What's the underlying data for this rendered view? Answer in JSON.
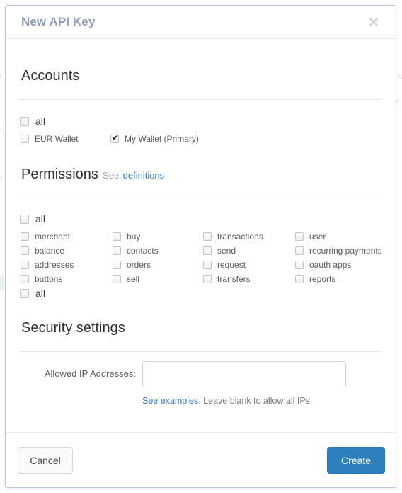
{
  "backdrop": {
    "ghost_fragments": [
      "t",
      "=",
      "1",
      "A",
      "c"
    ]
  },
  "modal": {
    "title": "New API Key",
    "close_icon": "close-icon",
    "sections": [
      {
        "id": "accounts",
        "heading": "Accounts",
        "all_label": "all",
        "all_checked": false,
        "items": [
          {
            "label": "EUR Wallet",
            "checked": false
          },
          {
            "label": "My Wallet (Primary)",
            "checked": true
          }
        ]
      },
      {
        "id": "permissions",
        "heading": "Permissions",
        "heading_suffix_plain": "See",
        "heading_suffix_link": "definitions",
        "all_label_top": "all",
        "all_checked_top": false,
        "all_label_bottom": "all",
        "all_checked_bottom": false,
        "columns": [
          {
            "items": [
              {
                "label": "merchant",
                "checked": false
              },
              {
                "label": "balance",
                "checked": false
              },
              {
                "label": "addresses",
                "checked": false
              },
              {
                "label": "buttons",
                "checked": false
              }
            ]
          },
          {
            "items": [
              {
                "label": "buy",
                "checked": false
              },
              {
                "label": "contacts",
                "checked": false
              },
              {
                "label": "orders",
                "checked": false
              },
              {
                "label": "sell",
                "checked": false
              }
            ]
          },
          {
            "items": [
              {
                "label": "transactions",
                "checked": false
              },
              {
                "label": "send",
                "checked": false
              },
              {
                "label": "request",
                "checked": false
              },
              {
                "label": "transfers",
                "checked": false
              }
            ]
          },
          {
            "items": [
              {
                "label": "user",
                "checked": false
              },
              {
                "label": "recurring payments",
                "checked": false
              },
              {
                "label": "oauth apps",
                "checked": false
              },
              {
                "label": "reports",
                "checked": false
              }
            ]
          }
        ]
      },
      {
        "id": "security",
        "heading": "Security settings",
        "field_label": "Allowed IP Addresses:",
        "field_value": "",
        "field_placeholder": "",
        "help_link": "See examples",
        "help_rest": ". Leave blank to allow all IPs."
      }
    ],
    "footer": {
      "cancel_label": "Cancel",
      "create_label": "Create"
    }
  },
  "colors": {
    "primary": "#2d7fbe",
    "link": "#3477c1",
    "title": "#8e9cb8",
    "modal_border": "#b9c6de",
    "rule": "#e8e8e8",
    "checkbox_border": "#c4c4c4"
  }
}
